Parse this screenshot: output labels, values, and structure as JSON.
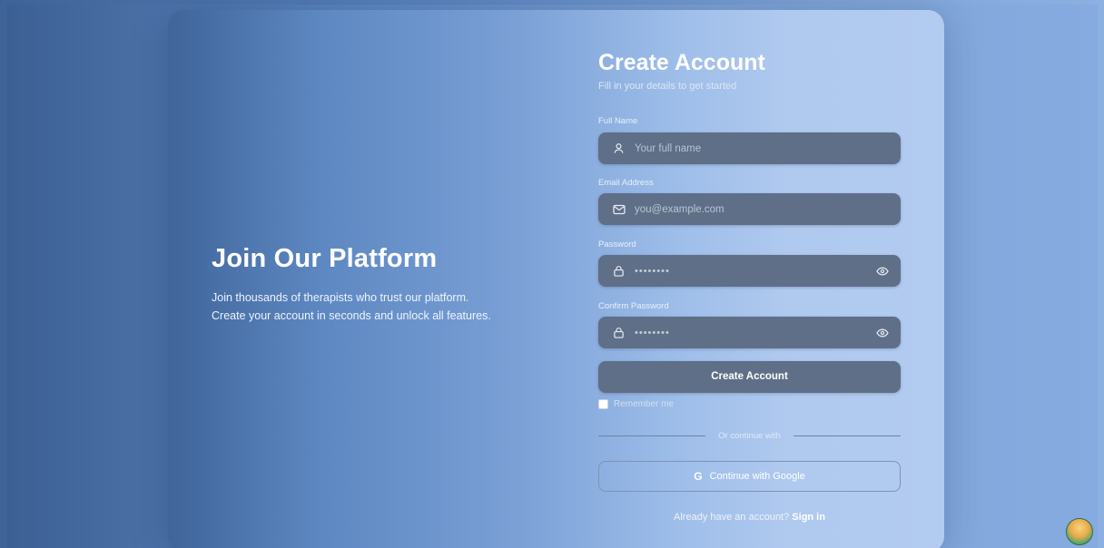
{
  "hero": {
    "title": "Join Our Platform",
    "line1": "Join thousands of therapists who trust our platform.",
    "line2": "Create your account in seconds and unlock all features."
  },
  "form": {
    "title": "Create Account",
    "subtitle": "Fill in your details to get started",
    "full_name": {
      "label": "Full Name",
      "placeholder": "Your full name",
      "icon": "user-icon"
    },
    "email": {
      "label": "Email Address",
      "placeholder": "you@example.com",
      "icon": "mail-icon"
    },
    "password": {
      "label": "Password",
      "value": "••••••••",
      "icon": "lock-icon"
    },
    "confirm_password": {
      "label": "Confirm Password",
      "value": "••••••••",
      "icon": "lock-icon"
    },
    "submit_label": "Create Account",
    "remember_label": "Remember me",
    "divider_label": "Or continue with",
    "google_label": "Continue with Google",
    "google_glyph": "G",
    "signin_prompt": "Already have an account?",
    "signin_link": "Sign in"
  },
  "colors": {
    "field_bg": "#5f6f87",
    "card_gradient_start": "#3f659a",
    "card_gradient_end": "#b2cbf0"
  }
}
